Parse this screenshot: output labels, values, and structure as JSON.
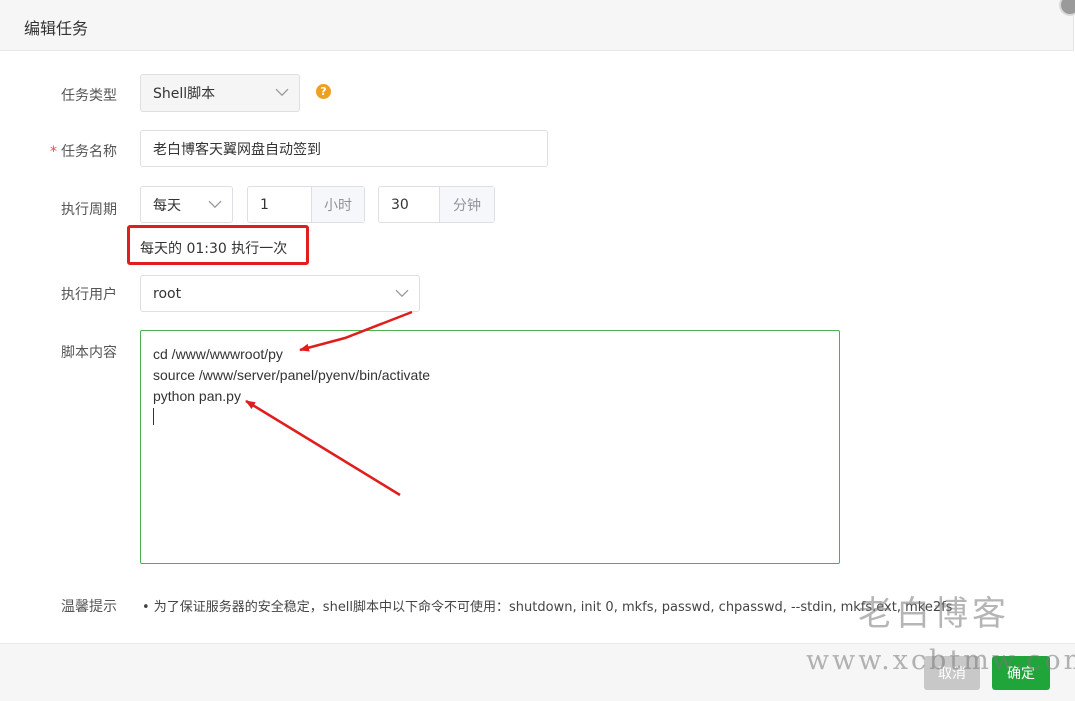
{
  "dialog": {
    "title": "编辑任务"
  },
  "form": {
    "task_type": {
      "label": "任务类型",
      "value": "Shell脚本"
    },
    "task_name": {
      "required_mark": "*",
      "label": "任务名称",
      "value": "老白博客天翼网盘自动签到"
    },
    "period": {
      "label": "执行周期",
      "frequency": "每天",
      "hour_value": "1",
      "hour_unit": "小时",
      "minute_value": "30",
      "minute_unit": "分钟",
      "preview": "每天的 01:30 执行一次"
    },
    "user": {
      "label": "执行用户",
      "value": "root"
    },
    "script": {
      "label": "脚本内容",
      "lines": [
        "cd /www/wwwroot/py",
        "source /www/server/panel/pyenv/bin/activate",
        "python pan.py"
      ]
    },
    "tip": {
      "label": "温馨提示",
      "text": "• 为了保证服务器的安全稳定，shell脚本中以下命令不可使用：shutdown, init 0, mkfs, passwd, chpasswd, --stdin, mkfs.ext, mke2fs"
    }
  },
  "footer": {
    "cancel_label": "取消",
    "ok_label": "确定"
  },
  "watermark": {
    "name": "老白博客",
    "url": "www.xcbtmw.com"
  },
  "colors": {
    "accent_green": "#20a53a",
    "highlight_red": "#e01e1e",
    "help_orange": "#f0a020"
  },
  "icons": {
    "help": "question-circle-icon",
    "dropdown": "chevron-down-icon"
  }
}
